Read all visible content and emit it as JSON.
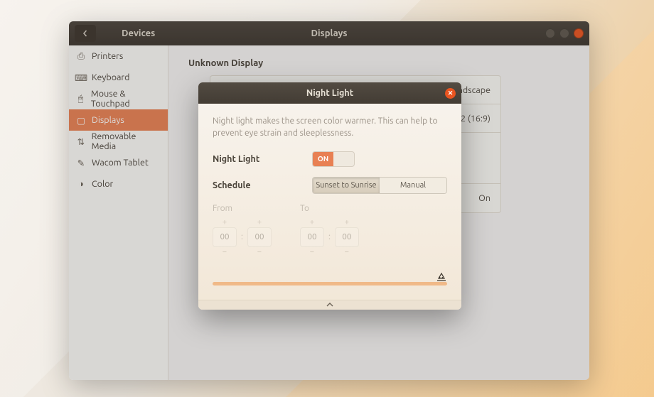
{
  "titlebar": {
    "section": "Devices",
    "page": "Displays"
  },
  "sidebar": {
    "items": [
      {
        "label": "Printers"
      },
      {
        "label": "Keyboard"
      },
      {
        "label": "Mouse & Touchpad"
      },
      {
        "label": "Displays"
      },
      {
        "label": "Removable Media"
      },
      {
        "label": "Wacom Tablet"
      },
      {
        "label": "Color"
      }
    ]
  },
  "content": {
    "section_title": "Unknown Display",
    "rows": {
      "orientation": "Landscape",
      "resolution": "048 × 1152 (16:9)",
      "night_light": "On"
    }
  },
  "dialog": {
    "title": "Night Light",
    "description": "Night light makes the screen color warmer. This can help to prevent eye strain and sleeplessness.",
    "night_light_label": "Night Light",
    "switch_on": "ON",
    "schedule_label": "Schedule",
    "schedule_options": {
      "auto": "Sunset to Sunrise",
      "manual": "Manual"
    },
    "time": {
      "from_label": "From",
      "to_label": "To",
      "from_h": "00",
      "from_m": "00",
      "to_h": "00",
      "to_m": "00",
      "plus": "+",
      "minus": "−",
      "colon": ":"
    }
  }
}
